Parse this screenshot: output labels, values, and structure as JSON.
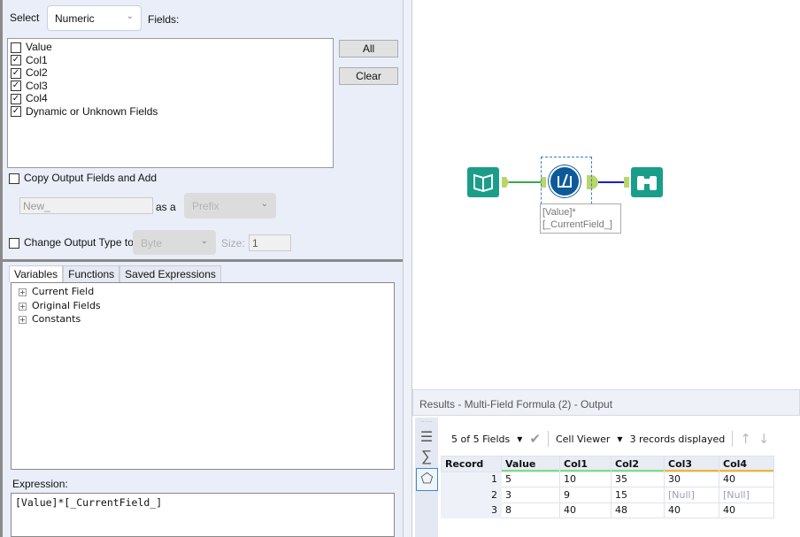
{
  "config": {
    "select_label": "Select",
    "select_value": "Numeric",
    "fields_label": "Fields:",
    "fields": [
      {
        "label": "Value",
        "checked": false
      },
      {
        "label": "Col1",
        "checked": true
      },
      {
        "label": "Col2",
        "checked": true
      },
      {
        "label": "Col3",
        "checked": true
      },
      {
        "label": "Col4",
        "checked": true
      },
      {
        "label": "Dynamic or Unknown Fields",
        "checked": true
      }
    ],
    "all_button": "All",
    "clear_button": "Clear",
    "copy_output_label": "Copy Output Fields and Add",
    "copy_output_checked": false,
    "prefix_value": "New_",
    "as_a_label": "as a",
    "prefix_type": "Prefix",
    "change_type_label": "Change Output Type to",
    "change_type_checked": false,
    "type_value": "Byte",
    "size_label": "Size:",
    "size_value": "1"
  },
  "expression_editor": {
    "tabs": [
      {
        "label": "Variables",
        "active": true
      },
      {
        "label": "Functions"
      },
      {
        "label": "Saved Expressions"
      }
    ],
    "tree": [
      "Current Field",
      "Original Fields",
      "Constants"
    ],
    "expression_label": "Expression:",
    "expression": "[Value]*[_CurrentField_]"
  },
  "canvas": {
    "annotation": [
      "[Value]*",
      "[_CurrentField_]"
    ],
    "tools": [
      "book-input-icon",
      "formula-icon",
      "binoculars-browse-icon"
    ],
    "tool_color": "#1a9e8a",
    "formula_color": "#0d5a9a"
  },
  "results": {
    "title": "Results - Multi-Field Formula (2) - Output",
    "fields_selector": "5 of 5 Fields",
    "cell_viewer": "Cell Viewer",
    "records_displayed": "3 records displayed",
    "columns": [
      "Record",
      "Value",
      "Col1",
      "Col2",
      "Col3",
      "Col4"
    ],
    "column_quality": [
      null,
      "#7ee07e",
      "#7ee07e",
      "#7ee07e",
      "#f5b62a",
      "#f5b62a"
    ],
    "rows": [
      [
        "1",
        "5",
        "10",
        "35",
        "30",
        "40"
      ],
      [
        "2",
        "3",
        "9",
        "15",
        "[Null]",
        "[Null]"
      ],
      [
        "3",
        "8",
        "40",
        "48",
        "40",
        "40"
      ]
    ]
  }
}
